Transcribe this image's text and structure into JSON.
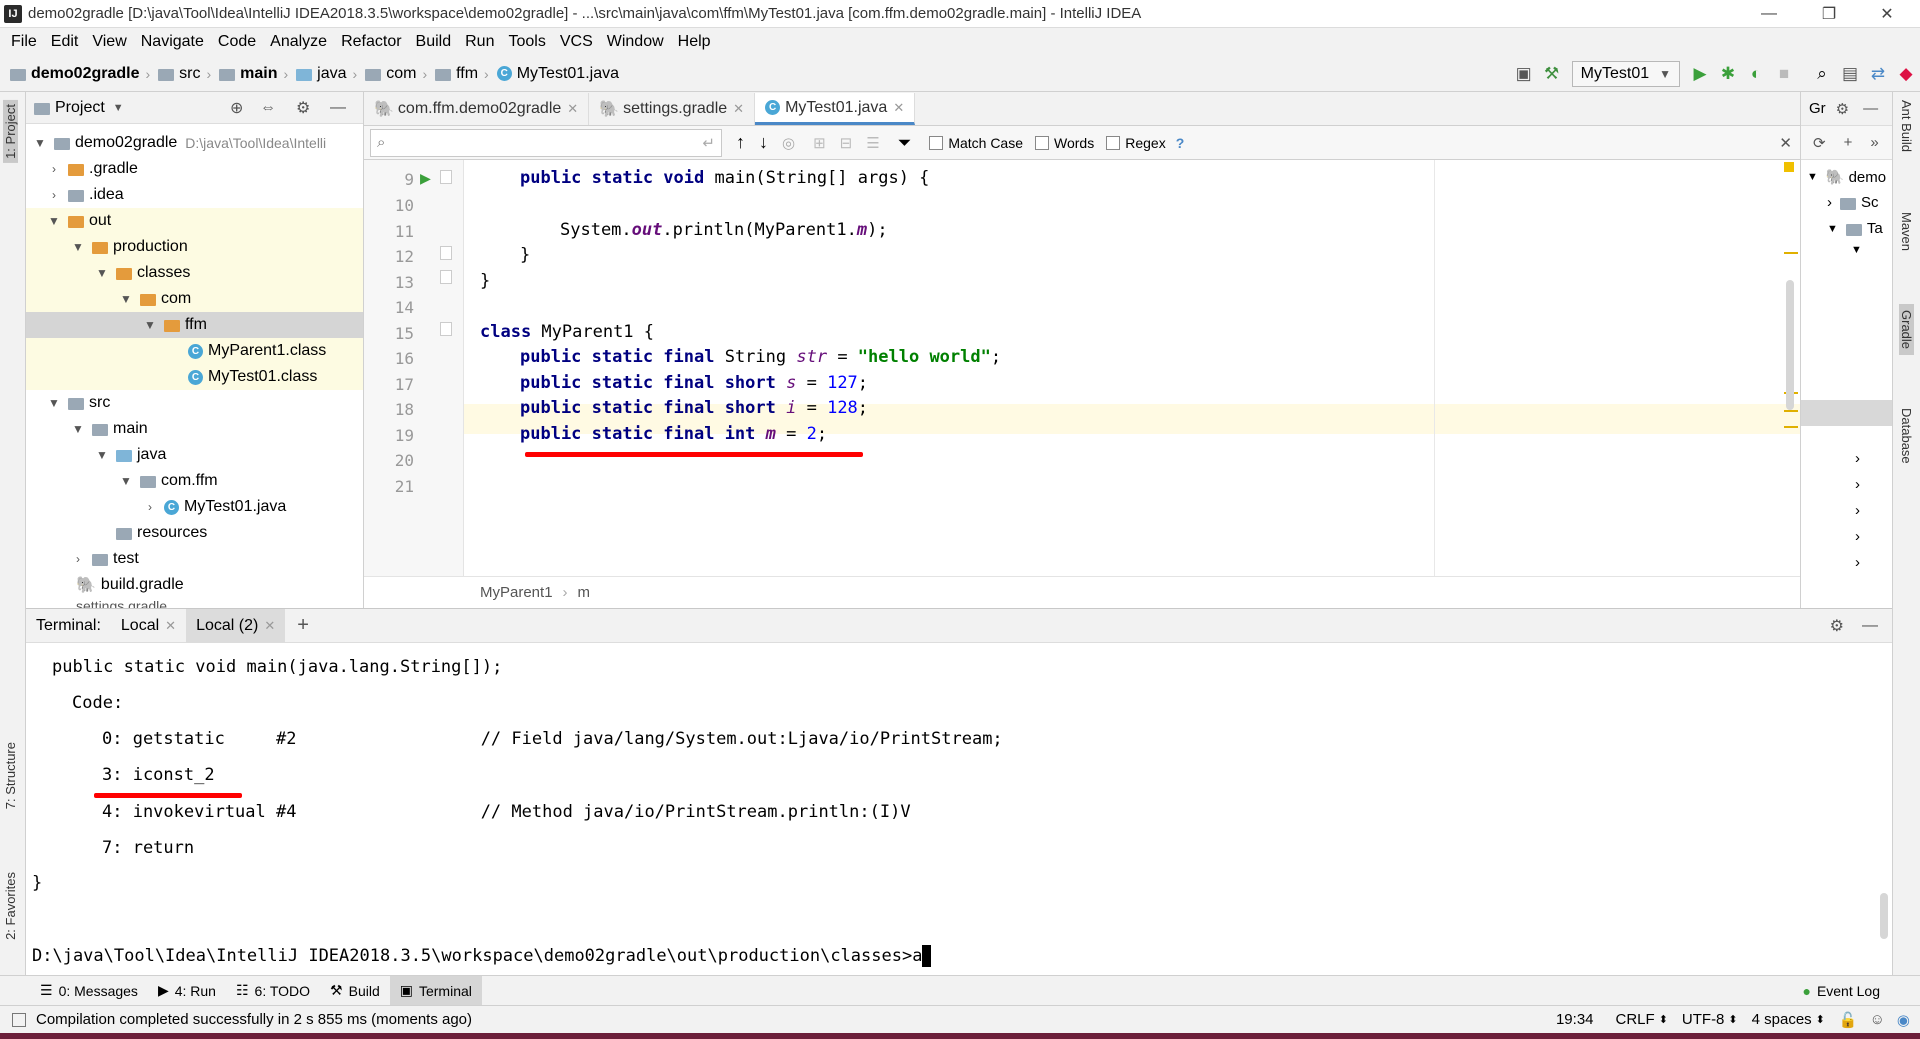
{
  "title": {
    "text": "demo02gradle [D:\\java\\Tool\\Idea\\IntelliJ IDEA2018.3.5\\workspace\\demo02gradle] - ...\\src\\main\\java\\com\\ffm\\MyTest01.java [com.ffm.demo02gradle.main] - IntelliJ IDEA",
    "app_icon": "IJ"
  },
  "menu": [
    "File",
    "Edit",
    "View",
    "Navigate",
    "Code",
    "Analyze",
    "Refactor",
    "Build",
    "Run",
    "Tools",
    "VCS",
    "Window",
    "Help"
  ],
  "breadcrumbs": [
    "demo02gradle",
    "src",
    "main",
    "java",
    "com",
    "ffm",
    "MyTest01.java"
  ],
  "run_config": "MyTest01",
  "project_panel": {
    "title": "Project",
    "tree": [
      {
        "label": "demo02gradle",
        "extra": "D:\\java\\Tool\\Idea\\Intelli"
      },
      {
        "label": ".gradle"
      },
      {
        "label": ".idea"
      },
      {
        "label": "out"
      },
      {
        "label": "production"
      },
      {
        "label": "classes"
      },
      {
        "label": "com"
      },
      {
        "label": "ffm"
      },
      {
        "label": "MyParent1.class"
      },
      {
        "label": "MyTest01.class"
      },
      {
        "label": "src"
      },
      {
        "label": "main"
      },
      {
        "label": "java"
      },
      {
        "label": "com.ffm"
      },
      {
        "label": "MyTest01.java"
      },
      {
        "label": "resources"
      },
      {
        "label": "test"
      },
      {
        "label": "build.gradle"
      },
      {
        "label": "settings.gradle"
      }
    ]
  },
  "editor_tabs": [
    {
      "label": "com.ffm.demo02gradle"
    },
    {
      "label": "settings.gradle"
    },
    {
      "label": "MyTest01.java"
    }
  ],
  "search": {
    "match_case": "Match Case",
    "words": "Words",
    "regex": "Regex",
    "help": "?"
  },
  "code": {
    "line_numbers": [
      "9",
      "10",
      "11",
      "12",
      "13",
      "14",
      "15",
      "16",
      "17",
      "18",
      "19",
      "20",
      "21"
    ],
    "l9_a": "public static void ",
    "l9_b": "main(String[] args) {",
    "l11_a": "System.",
    "l11_b": "out",
    "l11_c": ".println(MyParent1.",
    "l11_d": "m",
    "l11_e": ");",
    "l12": "}",
    "l13": "}",
    "l15_a": "class ",
    "l15_b": "MyParent1 {",
    "l16_a": "public static final ",
    "l16_b": "String ",
    "l16_c": "str",
    "l16_d": " = ",
    "l16_e": "\"hello world\"",
    "l16_f": ";",
    "l17_a": "public static final short ",
    "l17_b": "s",
    "l17_c": " = ",
    "l17_d": "127",
    "l17_e": ";",
    "l18_a": "public static final short ",
    "l18_b": "i",
    "l18_c": " = ",
    "l18_d": "128",
    "l18_e": ";",
    "l19_a": "public static final int ",
    "l19_b": "m",
    "l19_c": " = ",
    "l19_d": "2",
    "l19_e": ";"
  },
  "editor_breadcrumb": [
    "MyParent1",
    "m"
  ],
  "gradle_panel": {
    "title": "Gr",
    "items": [
      "demo",
      "Sc",
      "Ta"
    ]
  },
  "terminal": {
    "label": "Terminal:",
    "tabs": [
      "Local",
      "Local (2)"
    ],
    "lines": [
      "public static void main(java.lang.String[]);",
      "Code:",
      "0: getstatic     #2                  // Field java/lang/System.out:Ljava/io/PrintStream;",
      "3: iconst_2",
      "4: invokevirtual #4                  // Method java/io/PrintStream.println:(I)V",
      "7: return",
      "}",
      "D:\\java\\Tool\\Idea\\IntelliJ IDEA2018.3.5\\workspace\\demo02gradle\\out\\production\\classes>a"
    ]
  },
  "left_tool_tabs": [
    "1: Project",
    "7: Structure",
    "2: Favorites"
  ],
  "right_tool_tabs": [
    "Ant Build",
    "Maven",
    "Gradle",
    "Database"
  ],
  "bottom_tabs": [
    "0: Messages",
    "4: Run",
    "6: TODO",
    "Build",
    "Terminal"
  ],
  "event_log": "Event Log",
  "status": {
    "message": "Compilation completed successfully in 2 s 855 ms (moments ago)",
    "position": "19:34",
    "line_sep": "CRLF",
    "encoding": "UTF-8",
    "indent": "4 spaces"
  },
  "colors": {
    "keyword": "#000080",
    "string": "#008000",
    "number": "#0000ff",
    "field": "#660e7a",
    "annotation_red": "#ff0000"
  }
}
